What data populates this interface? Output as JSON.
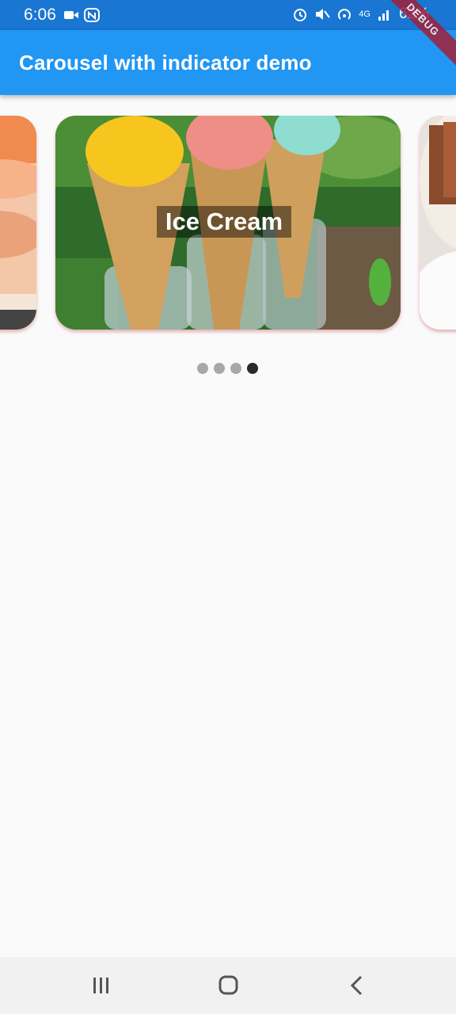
{
  "status_bar": {
    "time": "6:06",
    "battery": "62%",
    "network": "4G",
    "left_icons": [
      "video-camera-icon",
      "n-logo-icon"
    ],
    "right_icons": [
      "alarm-icon",
      "mute-icon",
      "hotspot-icon",
      "signal-icon",
      "battery-icon"
    ]
  },
  "app_bar": {
    "title": "Carousel with indicator demo",
    "color": "#2196f3"
  },
  "debug_banner": "DEBUG",
  "carousel": {
    "slides": [
      {
        "name": "left-partial-slide"
      },
      {
        "name": "center-slide",
        "caption": "Ice Cream"
      },
      {
        "name": "right-partial-slide"
      }
    ],
    "indicator": {
      "count": 4,
      "active_index": 3
    }
  },
  "nav_bar": {
    "icons": [
      "recents-icon",
      "home-icon",
      "back-icon"
    ]
  }
}
